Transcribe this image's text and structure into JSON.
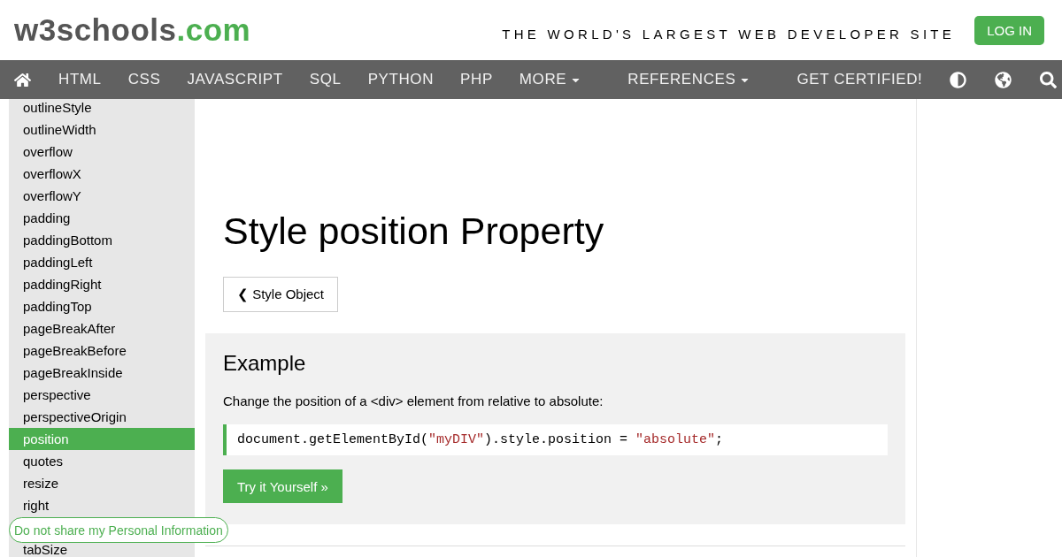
{
  "header": {
    "logo": {
      "name": "w3schools",
      "domain": ".com"
    },
    "tagline": "THE WORLD'S LARGEST WEB DEVELOPER SITE",
    "login": "LOG IN"
  },
  "nav": {
    "items": [
      {
        "label": "HTML",
        "kind": "link"
      },
      {
        "label": "CSS",
        "kind": "link"
      },
      {
        "label": "JAVASCRIPT",
        "kind": "link"
      },
      {
        "label": "SQL",
        "kind": "link"
      },
      {
        "label": "PYTHON",
        "kind": "link"
      },
      {
        "label": "PHP",
        "kind": "link"
      },
      {
        "label": "MORE",
        "kind": "dropdown"
      },
      {
        "label": "REFERENCES",
        "kind": "dropdown"
      },
      {
        "label": "GET CERTIFIED!",
        "kind": "link"
      }
    ]
  },
  "sidebar": {
    "items": [
      {
        "label": "outlineStyle",
        "selected": false
      },
      {
        "label": "outlineWidth",
        "selected": false
      },
      {
        "label": "overflow",
        "selected": false
      },
      {
        "label": "overflowX",
        "selected": false
      },
      {
        "label": "overflowY",
        "selected": false
      },
      {
        "label": "padding",
        "selected": false
      },
      {
        "label": "paddingBottom",
        "selected": false
      },
      {
        "label": "paddingLeft",
        "selected": false
      },
      {
        "label": "paddingRight",
        "selected": false
      },
      {
        "label": "paddingTop",
        "selected": false
      },
      {
        "label": "pageBreakAfter",
        "selected": false
      },
      {
        "label": "pageBreakBefore",
        "selected": false
      },
      {
        "label": "pageBreakInside",
        "selected": false
      },
      {
        "label": "perspective",
        "selected": false
      },
      {
        "label": "perspectiveOrigin",
        "selected": false
      },
      {
        "label": "position",
        "selected": true
      },
      {
        "label": "quotes",
        "selected": false
      },
      {
        "label": "resize",
        "selected": false
      },
      {
        "label": "right",
        "selected": false
      },
      {
        "label": "tabSize",
        "selected": false
      }
    ]
  },
  "main": {
    "title": "Style position Property",
    "back_button": "❮ Style Object",
    "example": {
      "heading": "Example",
      "description": "Change the position of a <div> element from relative to absolute:",
      "code": [
        {
          "text": "document.getElementById(",
          "kind": "plain"
        },
        {
          "text": "\"myDIV\"",
          "kind": "string"
        },
        {
          "text": ").style.position = ",
          "kind": "plain"
        },
        {
          "text": "\"absolute\"",
          "kind": "string"
        },
        {
          "text": ";",
          "kind": "plain"
        }
      ],
      "try_button": "Try it Yourself »"
    }
  },
  "privacy_button": "Do not share my Personal Information"
}
